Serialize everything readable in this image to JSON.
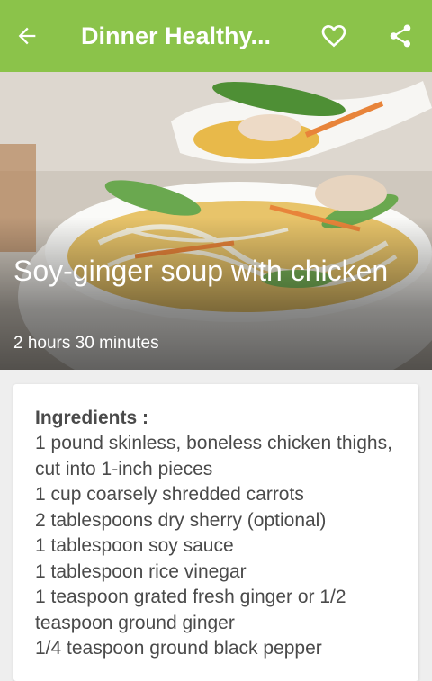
{
  "appbar": {
    "title": "Dinner Healthy...",
    "back_icon": "arrow-back-icon",
    "favorite_icon": "heart-outline-icon",
    "share_icon": "share-icon",
    "color": "#8bc34a"
  },
  "recipe": {
    "title": "Soy-ginger soup with chicken",
    "duration": "2 hours 30 minutes"
  },
  "ingredients": {
    "heading": "Ingredients :",
    "items": [
      "1 pound skinless, boneless chicken thighs, cut into 1-inch pieces",
      "1 cup coarsely shredded carrots",
      "2 tablespoons dry sherry (optional)",
      "1 tablespoon soy sauce",
      "1 tablespoon rice vinegar",
      "1 teaspoon grated fresh ginger or 1/2 teaspoon ground ginger",
      "1/4 teaspoon ground black pepper"
    ]
  }
}
